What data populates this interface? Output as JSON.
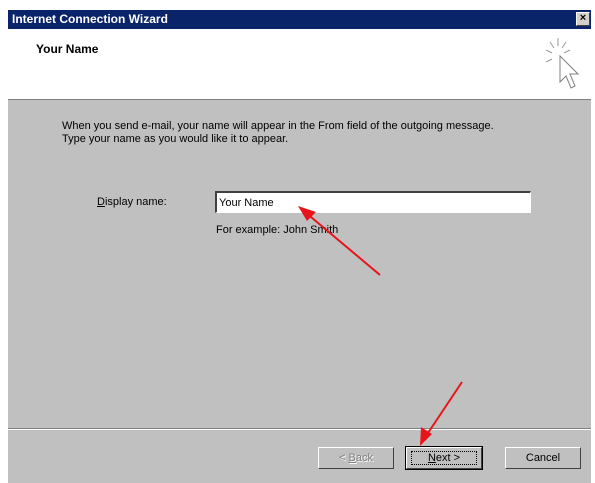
{
  "window": {
    "title": "Internet Connection Wizard",
    "close_glyph": "×"
  },
  "header": {
    "title": "Your Name",
    "icon": "wizard-cursor-icon"
  },
  "content": {
    "instruction_line1": "When you send e-mail, your name will appear in the From field of the outgoing message.",
    "instruction_line2": "Type your name as you would like it to appear.",
    "display_name_label_underline": "D",
    "display_name_label_rest": "isplay name:",
    "display_name_value": "Your Name",
    "example_text": "For example: John Smith"
  },
  "buttons": {
    "back_prefix": "< ",
    "back_underline": "B",
    "back_rest": "ack",
    "next_underline": "N",
    "next_rest": "ext >",
    "cancel_label": "Cancel"
  },
  "colors": {
    "titlebar": "#0a246a",
    "dialog_face": "#c0c0c0",
    "annotation_arrow": "#e8141b"
  },
  "annotations": {
    "icons": [
      "red-arrow-to-display-name",
      "red-arrow-to-next-button"
    ]
  }
}
